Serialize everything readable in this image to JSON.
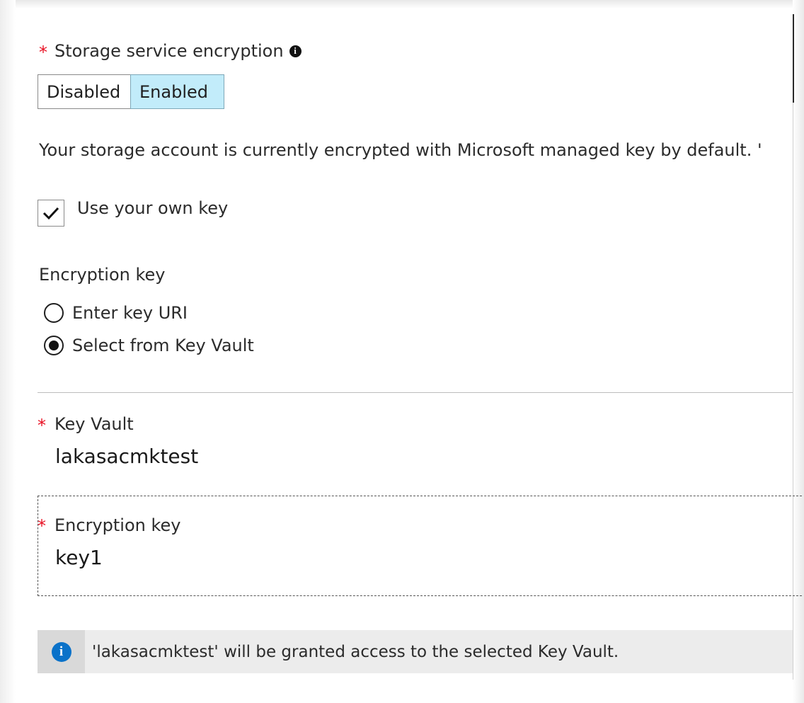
{
  "storage_encryption": {
    "label": "Storage service encryption",
    "required_mark": "*",
    "info_icon": "info-icon",
    "toggle": {
      "options": [
        "Disabled",
        "Enabled"
      ],
      "selected": "Enabled"
    }
  },
  "description": "Your storage account is currently encrypted with Microsoft managed key by default. '",
  "use_own_key": {
    "label": "Use your own key",
    "checked": true
  },
  "encryption_key_choice": {
    "title": "Encryption key",
    "options": [
      "Enter key URI",
      "Select from Key Vault"
    ],
    "selected": "Select from Key Vault"
  },
  "key_vault": {
    "label": "Key Vault",
    "required_mark": "*",
    "value": "lakasacmktest"
  },
  "encryption_key_field": {
    "label": "Encryption key",
    "required_mark": "*",
    "value": "key1"
  },
  "info_banner": {
    "icon": "info-icon",
    "text": "'lakasacmktest' will be granted access to the selected Key Vault."
  },
  "colors": {
    "required": "#e81123",
    "toggle_selected_bg": "#c2ecfa",
    "info_blue": "#0a72c9"
  }
}
